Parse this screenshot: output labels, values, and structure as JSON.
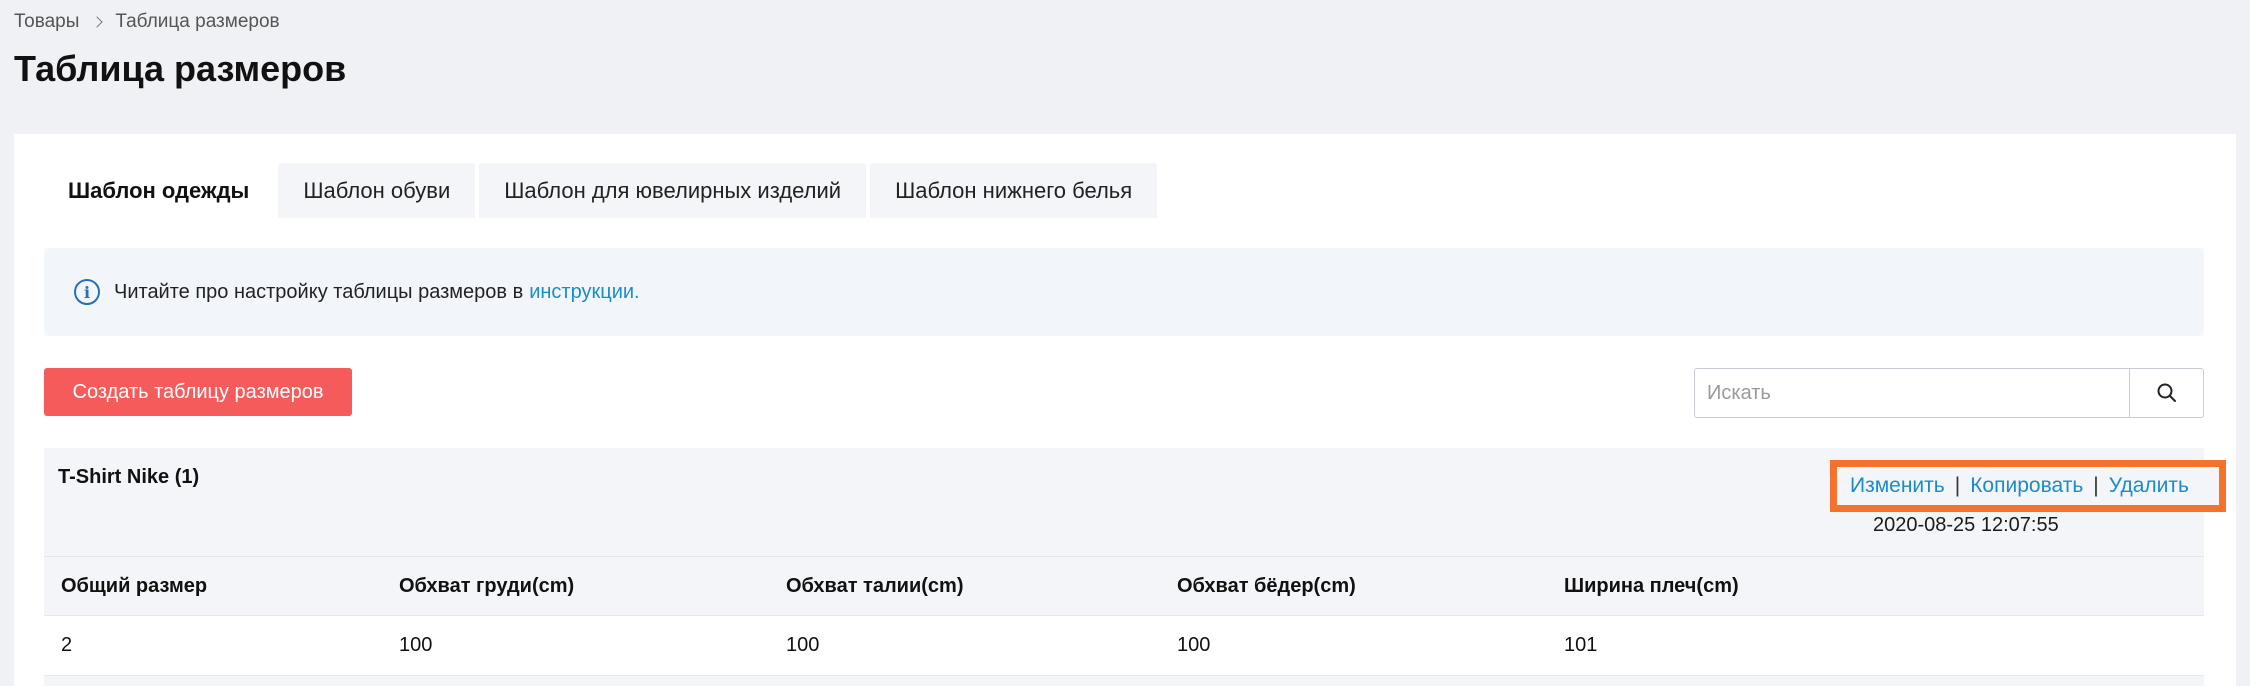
{
  "breadcrumb": {
    "parent": "Товары",
    "current": "Таблица размеров"
  },
  "page_title": "Таблица размеров",
  "tabs": [
    {
      "label": "Шаблон одежды",
      "active": true
    },
    {
      "label": "Шаблон обуви",
      "active": false
    },
    {
      "label": "Шаблон для ювелирных изделий",
      "active": false
    },
    {
      "label": "Шаблон нижнего белья",
      "active": false
    }
  ],
  "notice": {
    "text": "Читайте про настройку таблицы размеров в",
    "link": "инструкции."
  },
  "create_button": "Создать таблицу размеров",
  "search": {
    "placeholder": "Искать",
    "value": ""
  },
  "record": {
    "title": "T-Shirt Nike (1)",
    "actions": {
      "edit": "Изменить",
      "copy": "Копировать",
      "delete": "Удалить"
    },
    "timestamp": "2020-08-25 12:07:55",
    "columns": [
      "Общий размер",
      "Обхват груди(cm)",
      "Обхват талии(cm)",
      "Обхват бёдер(cm)",
      "Ширина плеч(cm)"
    ],
    "rows": [
      [
        "2",
        "100",
        "100",
        "100",
        "101"
      ]
    ]
  },
  "colors": {
    "accent": "#f55b5b",
    "link": "#1a8cc9",
    "highlight": "#f5722c"
  },
  "icons": {
    "info": "info-icon",
    "search": "search-icon",
    "breadcrumb_separator": "chevron-right-icon"
  }
}
